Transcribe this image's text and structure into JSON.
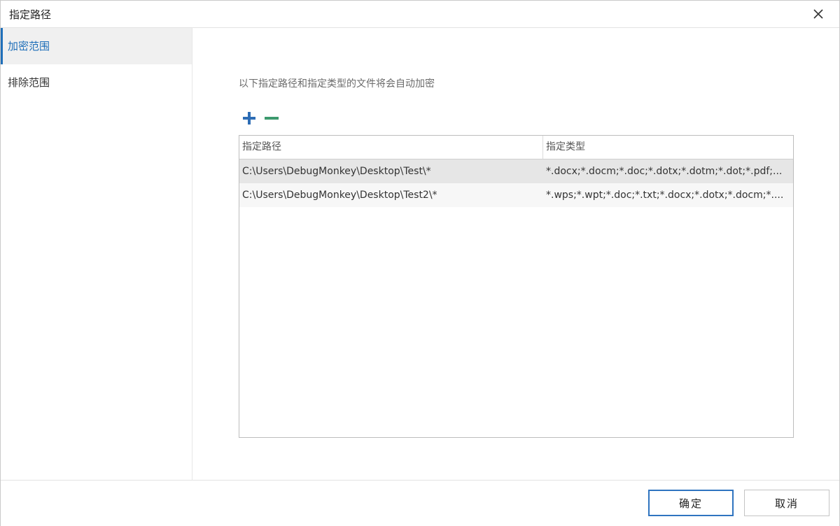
{
  "window": {
    "title": "指定路径"
  },
  "sidebar": {
    "items": [
      {
        "label": "加密范围"
      },
      {
        "label": "排除范围"
      }
    ]
  },
  "main": {
    "description": "以下指定路径和指定类型的文件将会自动加密",
    "table": {
      "headers": [
        "指定路径",
        "指定类型"
      ],
      "rows": [
        {
          "path": "C:\\Users\\DebugMonkey\\Desktop\\Test\\*",
          "types": "*.docx;*.docm;*.doc;*.dotx;*.dotm;*.dot;*.pdf;..."
        },
        {
          "path": "C:\\Users\\DebugMonkey\\Desktop\\Test2\\*",
          "types": "*.wps;*.wpt;*.doc;*.txt;*.docx;*.dotx;*.docm;*...."
        }
      ]
    }
  },
  "footer": {
    "ok_label": "确定",
    "cancel_label": "取消"
  },
  "icons": {
    "add": "plus-icon",
    "remove": "minus-icon",
    "close": "close-icon"
  },
  "colors": {
    "accent": "#1f6fb9",
    "add_icon": "#2d6db5",
    "remove_icon": "#3c9a6e"
  }
}
